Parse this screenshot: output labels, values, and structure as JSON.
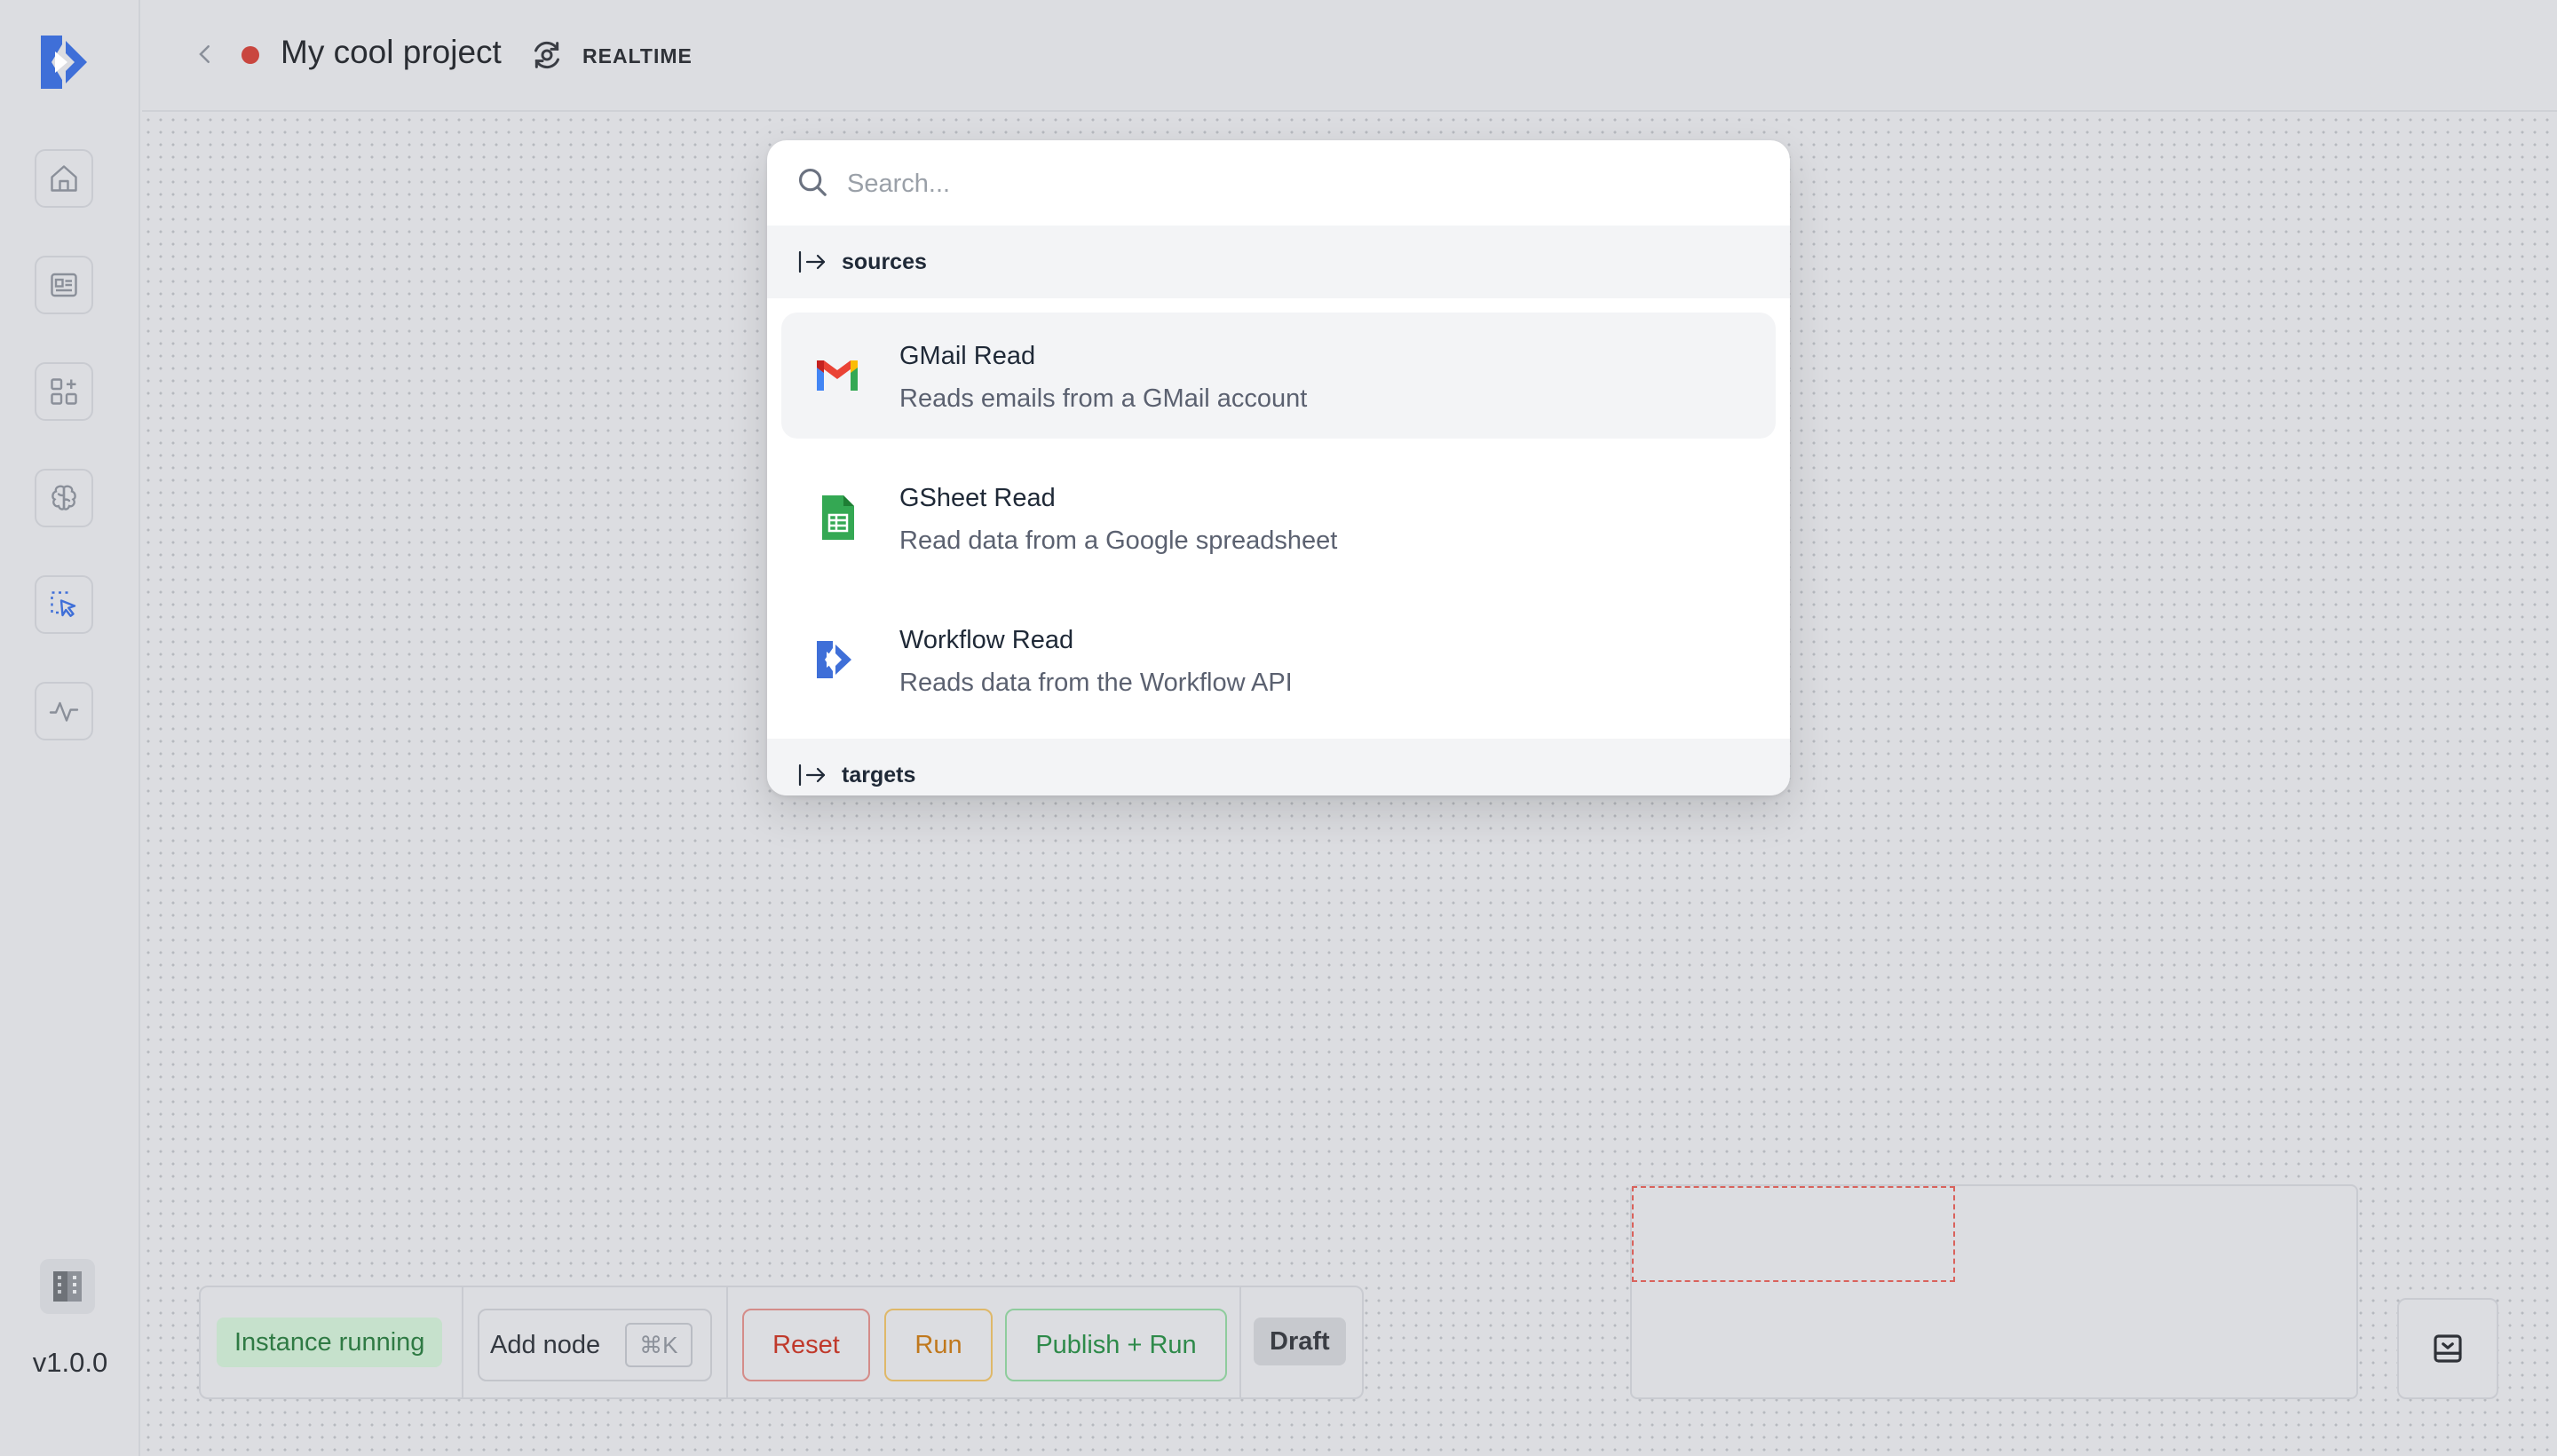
{
  "app": {
    "version": "v1.0.0"
  },
  "header": {
    "project_title": "My cool project",
    "mode_label": "REALTIME"
  },
  "sidebar": {
    "items": [
      {
        "name": "home",
        "icon": "home-icon"
      },
      {
        "name": "profile",
        "icon": "id-card-icon"
      },
      {
        "name": "components",
        "icon": "grid-plus-icon"
      },
      {
        "name": "models",
        "icon": "brain-icon"
      },
      {
        "name": "builder",
        "icon": "select-cursor-icon",
        "active": true
      },
      {
        "name": "activity",
        "icon": "activity-icon"
      }
    ]
  },
  "palette": {
    "search_placeholder": "Search...",
    "groups": [
      {
        "label": "sources",
        "items": [
          {
            "title": "GMail Read",
            "description": "Reads emails from a GMail account",
            "icon": "gmail-icon",
            "selected": true
          },
          {
            "title": "GSheet Read",
            "description": "Read data from a Google spreadsheet",
            "icon": "gsheet-icon"
          },
          {
            "title": "Workflow Read",
            "description": "Reads data from the Workflow API",
            "icon": "workflow-icon"
          }
        ]
      },
      {
        "label": "targets",
        "items": []
      }
    ]
  },
  "toolbar": {
    "status": "Instance running",
    "add_node": "Add node",
    "add_node_shortcut": "⌘K",
    "reset": "Reset",
    "run": "Run",
    "publish_run": "Publish + Run",
    "draft": "Draft"
  },
  "colors": {
    "status_dot": "#c9463f",
    "accent": "#3f6fd8",
    "running_bg": "#c6e1cc",
    "reset": "#c0392b",
    "run": "#c0781d",
    "publish": "#2e8a4a"
  }
}
